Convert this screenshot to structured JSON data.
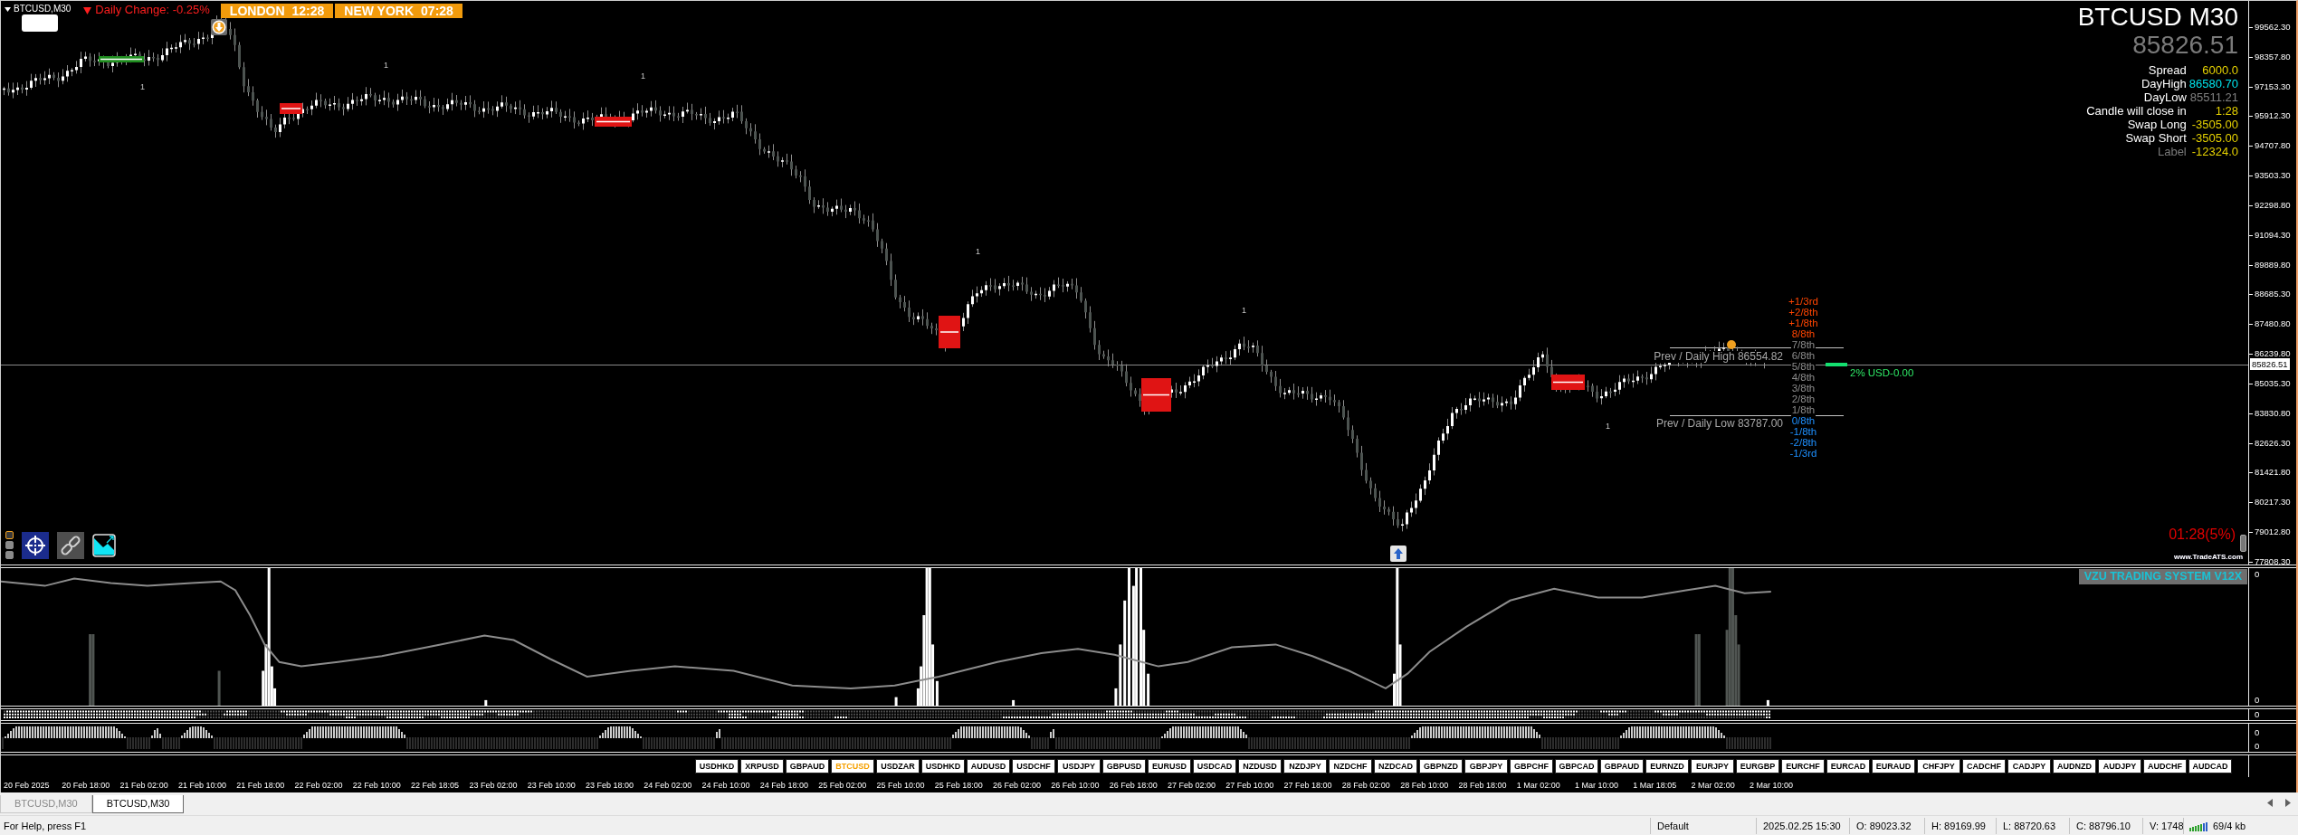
{
  "chart_header": {
    "symbol": "BTCUSD,M30",
    "daily_change": "Daily Change: -0.25%",
    "sessions": [
      {
        "city": "LONDON",
        "time": "12:28"
      },
      {
        "city": "NEW YORK",
        "time": "07:28"
      }
    ]
  },
  "info_panel": {
    "title": "BTCUSD M30",
    "price": "85826.51",
    "rows": [
      {
        "label": "Spread",
        "value": "6000.0",
        "color": "#e6d200",
        "label_muted": false
      },
      {
        "label": "DayHigh",
        "value": "86580.70",
        "color": "#00e5ee",
        "label_muted": false
      },
      {
        "label": "DayLow",
        "value": "85511.21",
        "color": "#808080",
        "label_muted": false
      },
      {
        "label": "Candle will close in",
        "value": "1:28",
        "color": "#e6d200",
        "label_muted": false
      },
      {
        "label": "Swap Long",
        "value": "-3505.00",
        "color": "#e6d200",
        "label_muted": false
      },
      {
        "label": "Swap Short",
        "value": "-3505.00",
        "color": "#e6d200",
        "label_muted": false
      },
      {
        "label": "Label",
        "value": "-12324.0",
        "color": "#e6d200",
        "label_muted": true
      }
    ]
  },
  "chart_marks": [
    "1",
    "1",
    "1",
    "1",
    "1",
    "1"
  ],
  "levels": {
    "fib": [
      {
        "label": "+1/3rd",
        "color": "#ff4500"
      },
      {
        "label": "+2/8th",
        "color": "#ff4500"
      },
      {
        "label": "+1/8th",
        "color": "#ff4500"
      },
      {
        "label": "8/8th",
        "color": "#ff4500"
      },
      {
        "label": "7/8th",
        "color": "#8c8c8c"
      },
      {
        "label": "6/8th",
        "color": "#8c8c8c"
      },
      {
        "label": "5/8th",
        "color": "#8c8c8c"
      },
      {
        "label": "4/8th",
        "color": "#8c8c8c"
      },
      {
        "label": "3/8th",
        "color": "#8c8c8c"
      },
      {
        "label": "2/8th",
        "color": "#8c8c8c"
      },
      {
        "label": "1/8th",
        "color": "#8c8c8c"
      },
      {
        "label": "0/8th",
        "color": "#1e90ff"
      },
      {
        "label": "-1/8th",
        "color": "#1e90ff"
      },
      {
        "label": "-2/8th",
        "color": "#1e90ff"
      },
      {
        "label": "-1/3rd",
        "color": "#1e90ff"
      }
    ],
    "prev_high": "Prev / Daily High 86554.82",
    "prev_low": "Prev / Daily Low 83787.00",
    "risk": "2% USD-0.00"
  },
  "timer": "01:28(5%)",
  "credit": "www.TradeATS.com",
  "price_axis": {
    "labels": [
      "99562.30",
      "98357.80",
      "97153.30",
      "95912.30",
      "94707.80",
      "93503.30",
      "92298.80",
      "91094.30",
      "89889.80",
      "88685.30",
      "87480.80",
      "86239.80",
      "85035.30",
      "83830.80",
      "82626.30",
      "81421.80",
      "80217.30",
      "79012.80",
      "77808.30"
    ],
    "current": "85826.51"
  },
  "indicator": {
    "title": "VZU TRADING SYSTEM V12X",
    "axis": [
      "0",
      "0"
    ]
  },
  "dots_pane": {
    "axis": [
      "0"
    ]
  },
  "wave_pane": {
    "axis": [
      "0",
      "0"
    ]
  },
  "symbols": [
    {
      "label": "USDHKD",
      "selected": false
    },
    {
      "label": "XRPUSD",
      "selected": false
    },
    {
      "label": "GBPAUD",
      "selected": false
    },
    {
      "label": "BTCUSD",
      "selected": true
    },
    {
      "label": "USDZAR",
      "selected": false
    },
    {
      "label": "USDHKD",
      "selected": false
    },
    {
      "label": "AUDUSD",
      "selected": false
    },
    {
      "label": "USDCHF",
      "selected": false
    },
    {
      "label": "USDJPY",
      "selected": false
    },
    {
      "label": "GBPUSD",
      "selected": false
    },
    {
      "label": "EURUSD",
      "selected": false
    },
    {
      "label": "USDCAD",
      "selected": false
    },
    {
      "label": "NZDUSD",
      "selected": false
    },
    {
      "label": "NZDJPY",
      "selected": false
    },
    {
      "label": "NZDCHF",
      "selected": false
    },
    {
      "label": "NZDCAD",
      "selected": false
    },
    {
      "label": "GBPNZD",
      "selected": false
    },
    {
      "label": "GBPJPY",
      "selected": false
    },
    {
      "label": "GBPCHF",
      "selected": false
    },
    {
      "label": "GBPCAD",
      "selected": false
    },
    {
      "label": "GBPAUD",
      "selected": false
    },
    {
      "label": "EURNZD",
      "selected": false
    },
    {
      "label": "EURJPY",
      "selected": false
    },
    {
      "label": "EURGBP",
      "selected": false
    },
    {
      "label": "EURCHF",
      "selected": false
    },
    {
      "label": "EURCAD",
      "selected": false
    },
    {
      "label": "EURAUD",
      "selected": false
    },
    {
      "label": "CHFJPY",
      "selected": false
    },
    {
      "label": "CADCHF",
      "selected": false
    },
    {
      "label": "CADJPY",
      "selected": false
    },
    {
      "label": "AUDNZD",
      "selected": false
    },
    {
      "label": "AUDJPY",
      "selected": false
    },
    {
      "label": "AUDCHF",
      "selected": false
    },
    {
      "label": "AUDCAD",
      "selected": false
    }
  ],
  "time_axis": [
    "20 Feb 2025",
    "20 Feb 18:00",
    "21 Feb 02:00",
    "21 Feb 10:00",
    "21 Feb 18:00",
    "22 Feb 02:00",
    "22 Feb 10:00",
    "22 Feb 18:05",
    "23 Feb 02:00",
    "23 Feb 10:00",
    "23 Feb 18:00",
    "24 Feb 02:00",
    "24 Feb 10:00",
    "24 Feb 18:00",
    "25 Feb 02:00",
    "25 Feb 10:00",
    "25 Feb 18:00",
    "26 Feb 02:00",
    "26 Feb 10:00",
    "26 Feb 18:00",
    "27 Feb 02:00",
    "27 Feb 10:00",
    "27 Feb 18:00",
    "28 Feb 02:00",
    "28 Feb 10:00",
    "28 Feb 18:00",
    "1 Mar 02:00",
    "1 Mar 10:00",
    "1 Mar 18:05",
    "2 Mar 02:00",
    "2 Mar 10:00"
  ],
  "tabs": [
    {
      "label": "BTCUSD,M30",
      "selected": false
    },
    {
      "label": "BTCUSD,M30",
      "selected": true
    }
  ],
  "status_bar": {
    "help": "For Help, press F1",
    "profile": "Default",
    "datetime": "2025.02.25 15:30",
    "open": "O: 89023.32",
    "high": "H: 89169.99",
    "low": "L: 88720.63",
    "close": "C: 88796.10",
    "volume": "V: 1748",
    "traffic": "69/4 kb"
  }
}
